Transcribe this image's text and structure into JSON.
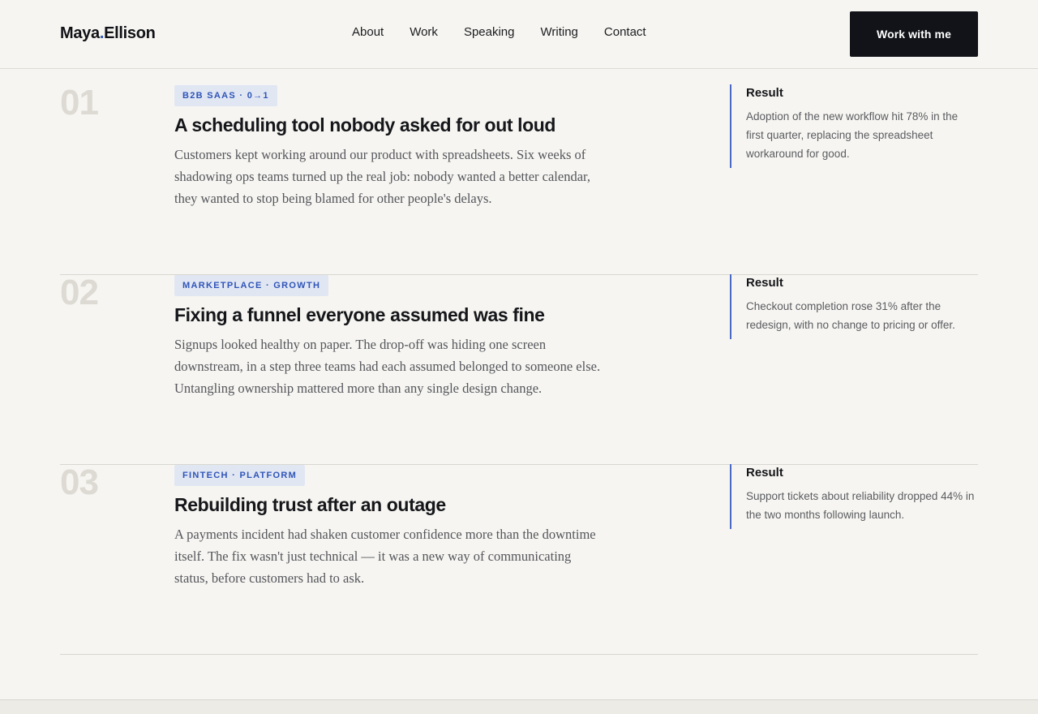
{
  "header": {
    "logo_first": "Maya",
    "logo_dot": ".",
    "logo_last": "Ellison",
    "nav": [
      {
        "label": "About"
      },
      {
        "label": "Work"
      },
      {
        "label": "Speaking"
      },
      {
        "label": "Writing"
      },
      {
        "label": "Contact"
      }
    ],
    "cta_label": "Work with me"
  },
  "cases": [
    {
      "number": "01",
      "tag": "B2B SAAS · 0→1",
      "title": "A scheduling tool nobody asked for out loud",
      "body": "Customers kept working around our product with spreadsheets. Six weeks of shadowing ops teams turned up the real job: nobody wanted a better calendar, they wanted to stop being blamed for other people's delays.",
      "result_label": "Result",
      "result_text": "Adoption of the new workflow hit 78% in the first quarter, replacing the spreadsheet workaround for good."
    },
    {
      "number": "02",
      "tag": "MARKETPLACE · GROWTH",
      "title": "Fixing a funnel everyone assumed was fine",
      "body": "Signups looked healthy on paper. The drop-off was hiding one screen downstream, in a step three teams had each assumed belonged to someone else. Untangling ownership mattered more than any single design change.",
      "result_label": "Result",
      "result_text": "Checkout completion rose 31% after the redesign, with no change to pricing or offer."
    },
    {
      "number": "03",
      "tag": "FINTECH · PLATFORM",
      "title": "Rebuilding trust after an outage",
      "body": "A payments incident had shaken customer confidence more than the downtime itself. The fix wasn't just technical — it was a new way of communicating status, before customers had to ask.",
      "result_label": "Result",
      "result_text": "Support tickets about reliability dropped 44% in the two months following launch."
    }
  ],
  "colors": {
    "background": "#f6f5f1",
    "accent": "#2f55b8",
    "tag_bg": "#e1e6f3",
    "cta_bg": "#111318"
  }
}
